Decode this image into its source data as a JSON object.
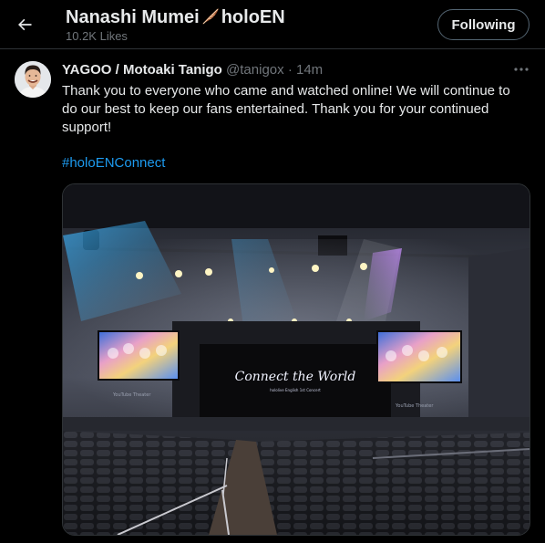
{
  "header": {
    "title": "Nanashi Mumei",
    "title_suffix": "holoEN",
    "subtitle": "10.2K Likes",
    "follow_label": "Following"
  },
  "tweet": {
    "author_name": "YAGOO / Motoaki Tanigo",
    "handle": "@tanigox",
    "separator": "·",
    "time": "14m",
    "text": "Thank you to everyone who came and watched online! We will continue to do our best to keep our fans entertained. Thank you for your continued support!",
    "hashtag": "#holoENConnect"
  },
  "screen_text": {
    "logo_main": "Connect the World",
    "logo_sub": "hololive English 1st Concert",
    "youtube_left": "YouTube Theater",
    "youtube_right": "YouTube Theater"
  },
  "icons": {
    "back": "arrow-left-icon",
    "feather": "feather-emoji-icon",
    "more": "more-dots-icon"
  },
  "colors": {
    "background": "#000000",
    "text_primary": "#e7e9ea",
    "text_secondary": "#71767b",
    "link": "#1d9bf0",
    "border": "#2f3336"
  }
}
